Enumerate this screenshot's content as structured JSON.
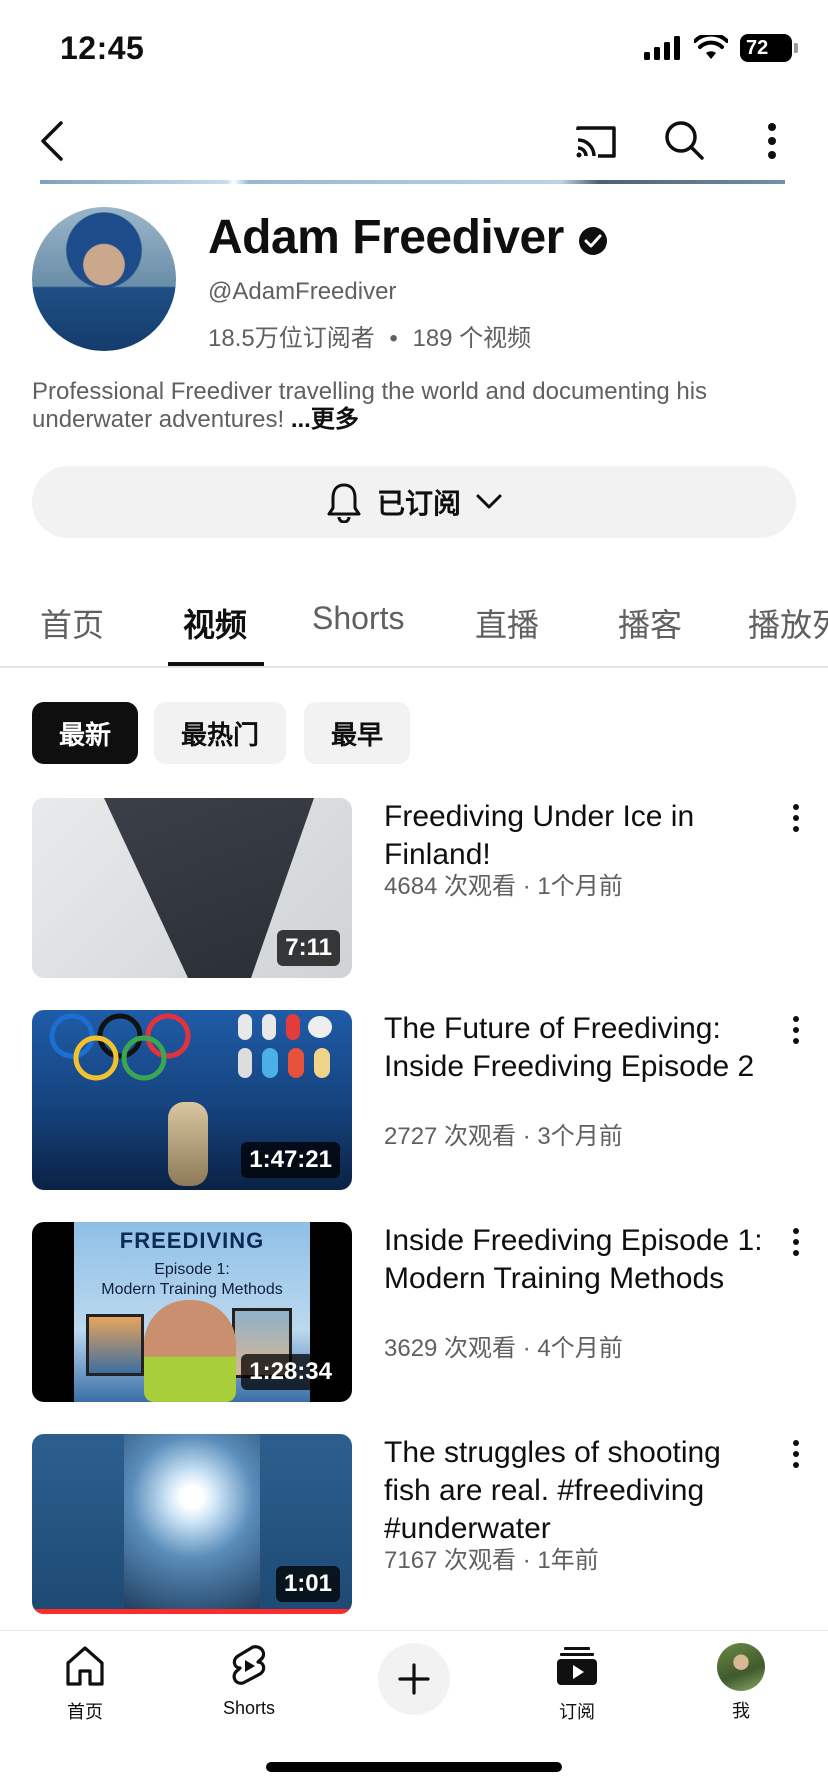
{
  "status": {
    "time": "12:45",
    "battery": "72"
  },
  "channel": {
    "name": "Adam Freediver",
    "handle": "@AdamFreediver",
    "subscribers": "18.5万位订阅者",
    "separator": "•",
    "video_count": "189 个视频",
    "description": "Professional Freediver travelling the world and documenting his underwater adventures!",
    "more_label": "...更多",
    "subscribe_label": "已订阅"
  },
  "tabs": [
    {
      "label": "首页"
    },
    {
      "label": "视频"
    },
    {
      "label": "Shorts"
    },
    {
      "label": "直播"
    },
    {
      "label": "播客"
    },
    {
      "label": "播放列"
    }
  ],
  "filters": [
    {
      "label": "最新",
      "selected": true
    },
    {
      "label": "最热门",
      "selected": false
    },
    {
      "label": "最早",
      "selected": false
    }
  ],
  "videos": [
    {
      "title": "Freediving Under Ice in Finland!",
      "meta": "4684 次观看 · 1个月前",
      "duration": "7:11"
    },
    {
      "title": "The Future of Freediving: Inside Freediving Episode 2",
      "meta": "2727 次观看 · 3个月前",
      "duration": "1:47:21"
    },
    {
      "title": "Inside Freediving Episode 1: Modern Training Methods",
      "meta": "3629 次观看 · 4个月前",
      "duration": "1:28:34",
      "thumb_heading": "FREEDIVING",
      "thumb_subtitle_1": "Episode 1:",
      "thumb_subtitle_2": "Modern Training Methods"
    },
    {
      "title": "The struggles of shooting fish are real. #freediving #underwater",
      "meta": "7167 次观看 · 1年前",
      "duration": "1:01"
    }
  ],
  "bottom_nav": [
    {
      "label": "首页",
      "icon": "home-icon"
    },
    {
      "label": "Shorts",
      "icon": "shorts-icon"
    },
    {
      "label": "",
      "icon": "plus-icon"
    },
    {
      "label": "订阅",
      "icon": "subscriptions-icon"
    },
    {
      "label": "我",
      "icon": "avatar"
    }
  ]
}
